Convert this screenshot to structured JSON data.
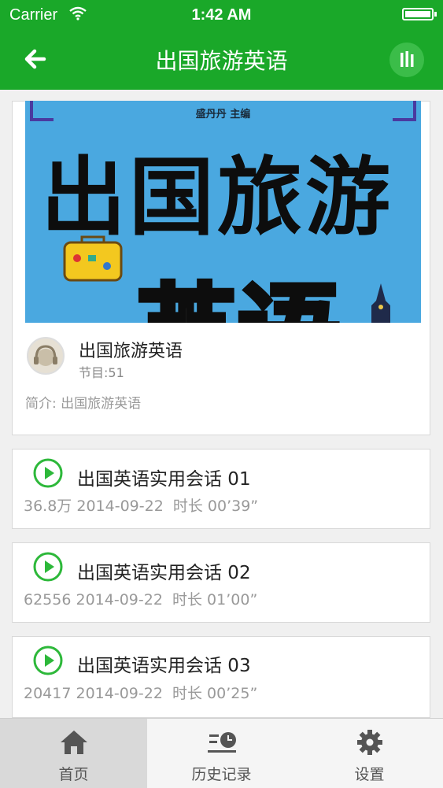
{
  "status_bar": {
    "carrier": "Carrier",
    "time": "1:42 AM"
  },
  "nav": {
    "title": "出国旅游英语"
  },
  "album": {
    "cover_editor": "盛丹丹 主编",
    "cover_title_line1": "出国旅游",
    "cover_title_line2": "英语",
    "title": "出国旅游英语",
    "count": "节目:51",
    "description": "简介: 出国旅游英语"
  },
  "episodes": [
    {
      "title": "出国英语实用会话 01",
      "plays": "36.8万",
      "date": "2014-09-22",
      "duration": "时长 00’39”"
    },
    {
      "title": "出国英语实用会话 02",
      "plays": "62556",
      "date": "2014-09-22",
      "duration": "时长 01’00”"
    },
    {
      "title": "出国英语实用会话 03",
      "plays": "20417",
      "date": "2014-09-22",
      "duration": "时长 00’25”"
    }
  ],
  "tabbar": {
    "home": "首页",
    "history": "历史记录",
    "settings": "设置"
  },
  "colors": {
    "brand_green": "#1aa829",
    "accent_green": "#3bbd49"
  }
}
